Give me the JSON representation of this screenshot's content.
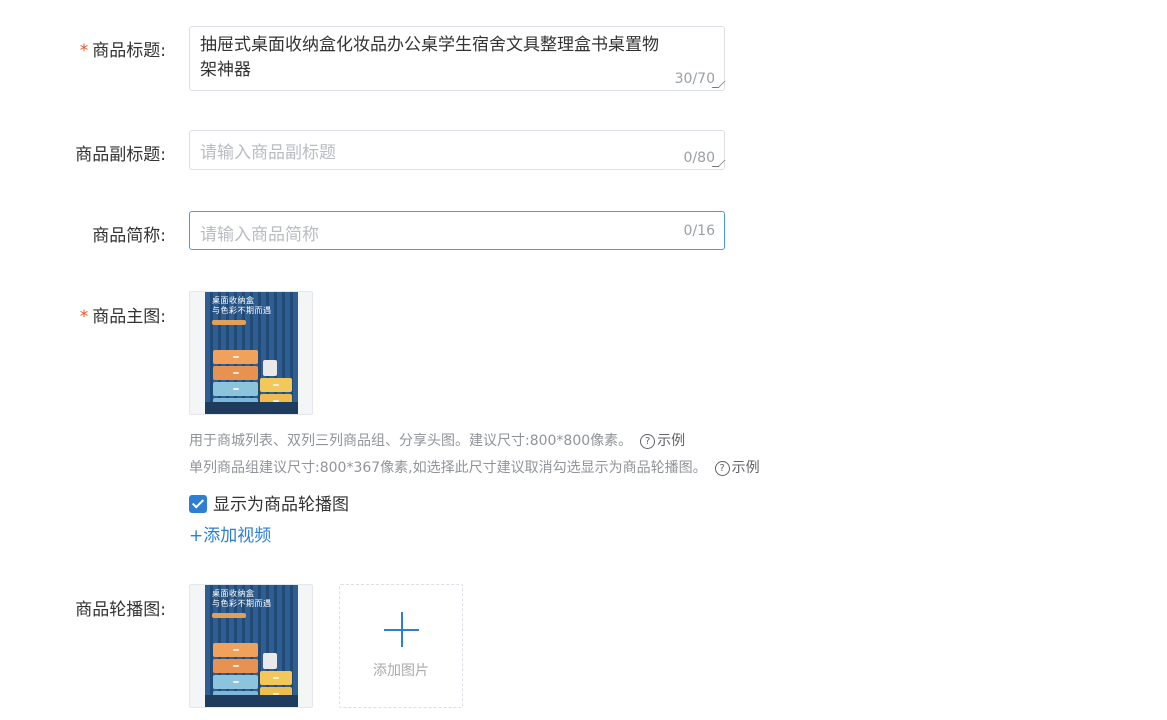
{
  "title_field": {
    "required_mark": "*",
    "label": "商品标题:",
    "value": "抽屉式桌面收纳盒化妆品办公桌学生宿舍文具整理盒书桌置物架神器",
    "count": "30/70"
  },
  "subtitle_field": {
    "label": "商品副标题:",
    "placeholder": "请输入商品副标题",
    "count": "0/80"
  },
  "short_name_field": {
    "label": "商品简称:",
    "placeholder": "请输入商品简称",
    "count": "0/16"
  },
  "main_image": {
    "required_mark": "*",
    "label": "商品主图:",
    "image_text_line1": "桌面收纳盒",
    "image_text_line2": "与色彩不期而遇",
    "help_line1": "用于商城列表、双列三列商品组、分享头图。建议尺寸:800*800像素。",
    "help_line2": "单列商品组建议尺寸:800*367像素,如选择此尺寸建议取消勾选显示为商品轮播图。",
    "example_icon": "question-circle-icon",
    "example_label": "示例",
    "carousel_checkbox_label": "显示为商品轮播图",
    "carousel_checked": true,
    "add_video_link": "+添加视频"
  },
  "carousel": {
    "label": "商品轮播图:",
    "image_text_line1": "桌面收纳盒",
    "image_text_line2": "与色彩不期而遇",
    "upload_label": "添加图片",
    "upload_icon": "plus-icon"
  },
  "colors": {
    "accent": "#2d7fd3",
    "required": "#e9552a",
    "focus_border": "#4a9be0"
  }
}
